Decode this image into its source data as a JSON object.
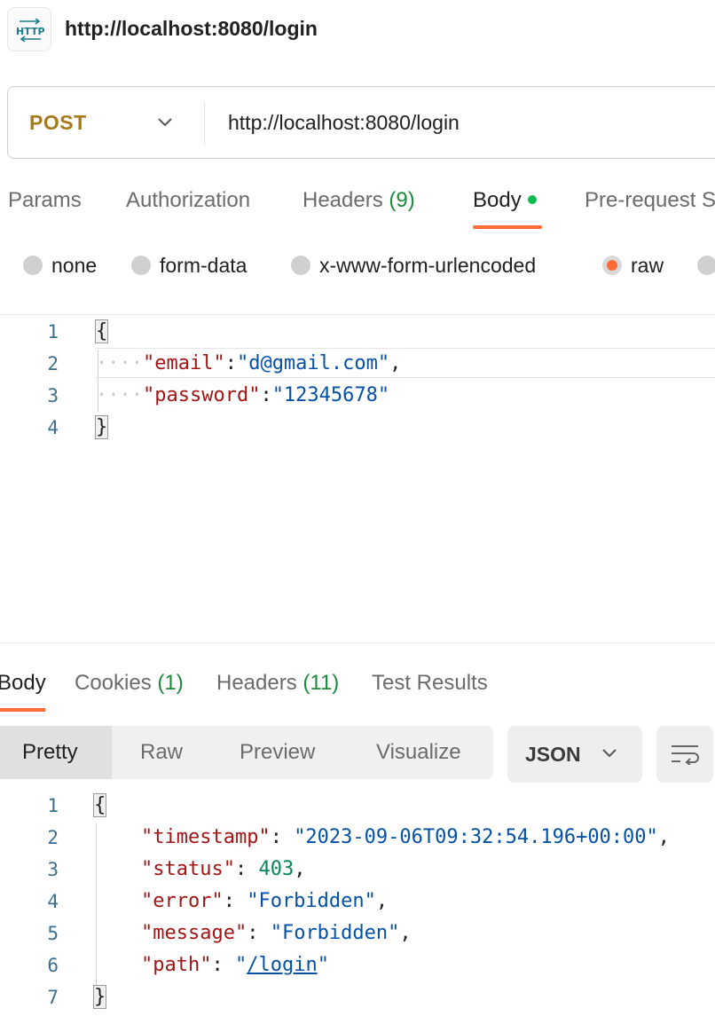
{
  "header": {
    "title": "http://localhost:8080/login",
    "icon": "http-icon"
  },
  "request": {
    "method": "POST",
    "url": "http://localhost:8080/login",
    "tabs": [
      {
        "label": "Params"
      },
      {
        "label": "Authorization"
      },
      {
        "label": "Headers",
        "count": "(9)"
      },
      {
        "label": "Body"
      },
      {
        "label": "Pre-request S"
      }
    ],
    "body_types": [
      "none",
      "form-data",
      "x-www-form-urlencoded",
      "raw"
    ],
    "selected_body_type": "raw",
    "editor": {
      "line_numbers": [
        "1",
        "2",
        "3",
        "4"
      ],
      "open_brace": "{",
      "close_brace": "}",
      "email_key": "\"email\"",
      "email_value": "\"d@gmail.com\"",
      "password_key": "\"password\"",
      "password_value": "\"12345678\""
    }
  },
  "response": {
    "tabs": [
      {
        "label": "Body"
      },
      {
        "label": "Cookies",
        "count": "(1)"
      },
      {
        "label": "Headers",
        "count": "(11)"
      },
      {
        "label": "Test Results"
      }
    ],
    "views": [
      "Pretty",
      "Raw",
      "Preview",
      "Visualize"
    ],
    "format": "JSON",
    "body": {
      "line_numbers": [
        "1",
        "2",
        "3",
        "4",
        "5",
        "6",
        "7"
      ],
      "open_brace": "{",
      "close_brace": "}",
      "timestamp_key": "\"timestamp\"",
      "timestamp_value": "\"2023-09-06T09:32:54.196+00:00\"",
      "status_key": "\"status\"",
      "status_value": "403",
      "error_key": "\"error\"",
      "error_value": "\"Forbidden\"",
      "message_key": "\"message\"",
      "message_value": "\"Forbidden\"",
      "path_key": "\"path\"",
      "path_value": "/login"
    }
  },
  "colors": {
    "accent": "#ff6c37",
    "method": "#a87a1a",
    "count_green": "#1e8a3e",
    "dot_green": "#0cbb52"
  }
}
